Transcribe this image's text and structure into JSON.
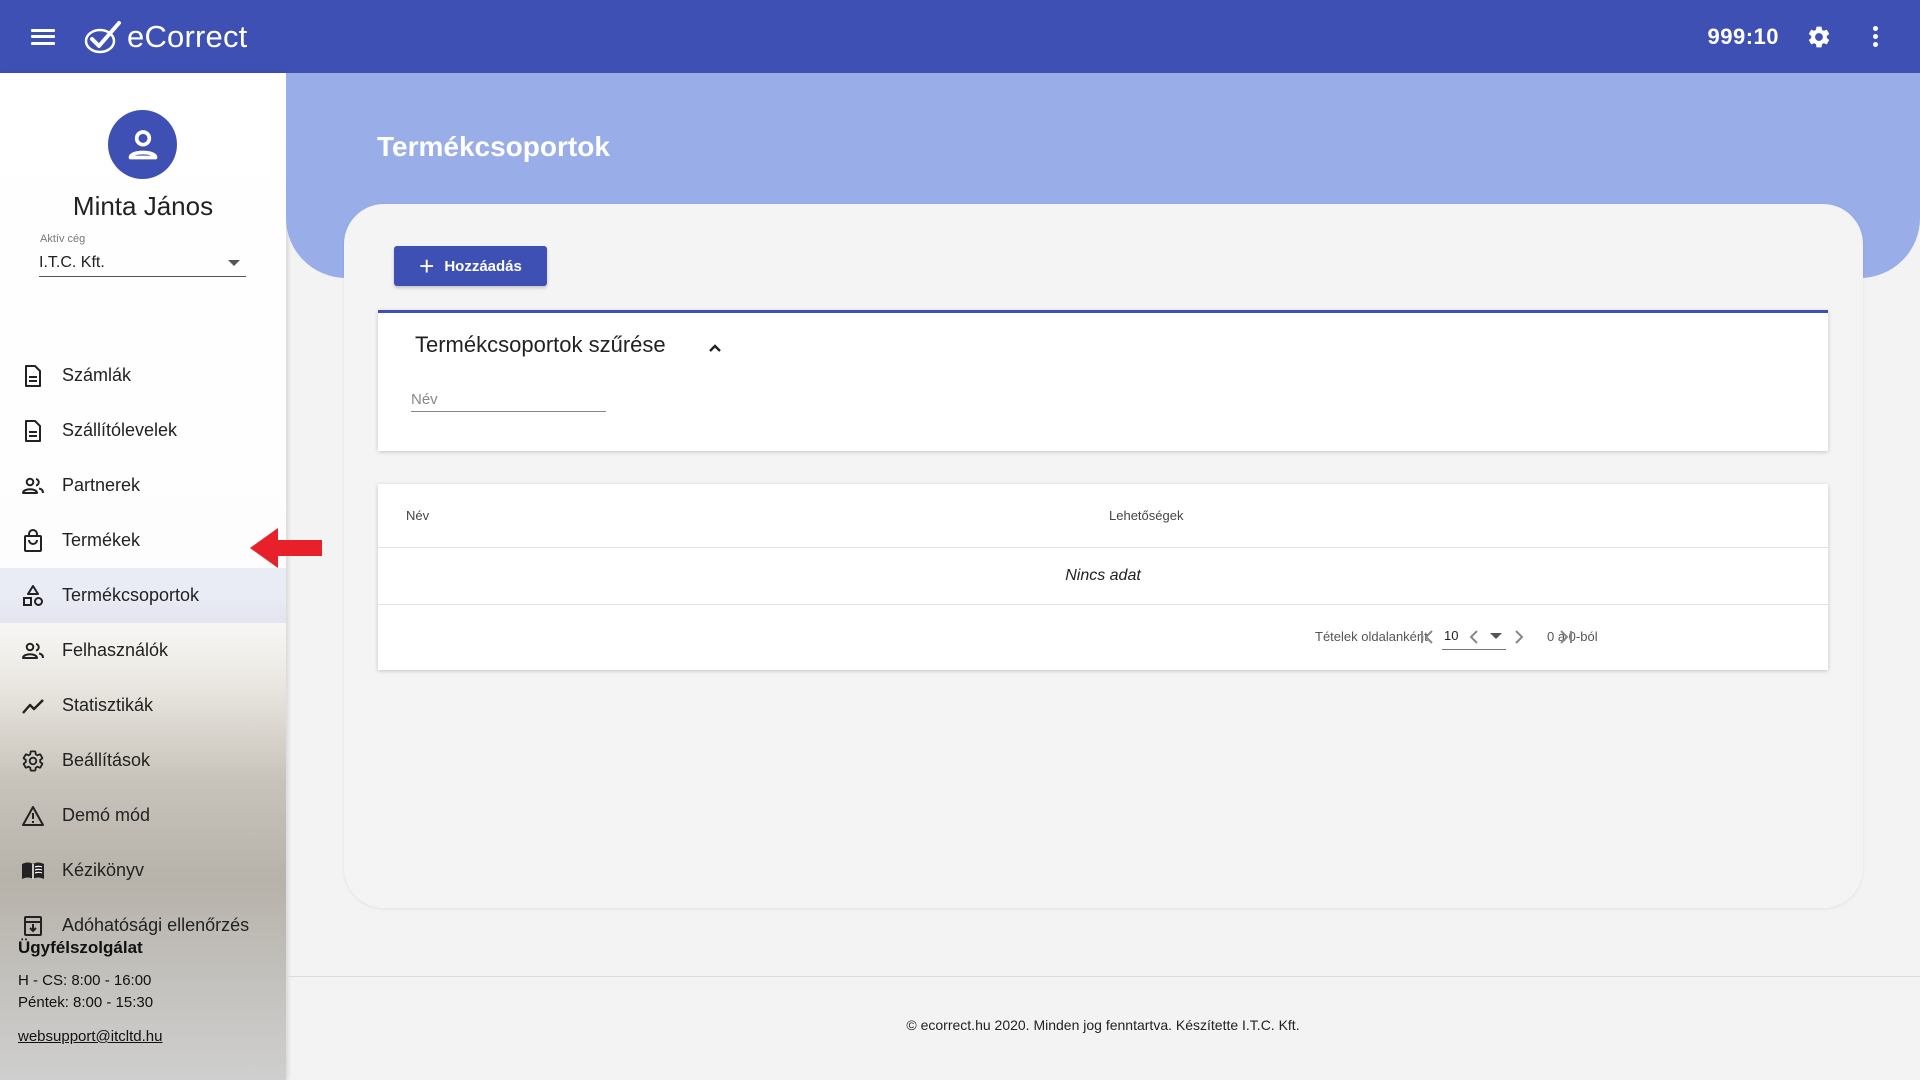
{
  "topbar": {
    "app_name": "eCorrect",
    "timer": "999:10",
    "icons": [
      "menu-icon",
      "ecorrect-logo",
      "gear-icon",
      "more-vert-icon"
    ]
  },
  "sidebar": {
    "user_name": "Minta János",
    "company_label": "Aktív cég",
    "company_value": "I.T.C. Kft.",
    "items": [
      {
        "label": "Számlák",
        "icon": "document-icon"
      },
      {
        "label": "Szállítólevelek",
        "icon": "document-icon"
      },
      {
        "label": "Partnerek",
        "icon": "people-icon"
      },
      {
        "label": "Termékek",
        "icon": "shopping-bag-icon"
      },
      {
        "label": "Termékcsoportok",
        "icon": "category-icon",
        "active": true
      },
      {
        "label": "Felhasználók",
        "icon": "people-icon"
      },
      {
        "label": "Statisztikák",
        "icon": "trending-icon"
      },
      {
        "label": "Beállítások",
        "icon": "gear-icon"
      },
      {
        "label": "Demó mód",
        "icon": "warning-icon"
      },
      {
        "label": "Kézikönyv",
        "icon": "book-icon"
      },
      {
        "label": "Adóhatósági ellenőrzés",
        "icon": "archive-icon"
      }
    ],
    "support": {
      "title": "Ügyfélszolgálat",
      "hours_weekdays": "H - CS: 8:00 - 16:00",
      "hours_friday": "Péntek: 8:00 - 15:30",
      "email": "websupport@itcltd.hu"
    }
  },
  "main": {
    "page_title": "Termékcsoportok",
    "add_button": "Hozzáadás",
    "filter": {
      "title": "Termékcsoportok szűrése",
      "name_placeholder": "Név"
    },
    "table": {
      "columns": [
        "Név",
        "Lehetőségek"
      ],
      "empty_text": "Nincs adat",
      "rows_per_page_label": "Tételek oldalanként",
      "rows_per_page": "10",
      "range_text": "0 a 0-ból"
    }
  },
  "footer": {
    "text": "© ecorrect.hu 2020. Minden jog fenntartva. Készítette I.T.C. Kft."
  },
  "colors": {
    "primary": "#3e50b4",
    "hero": "#99ade8",
    "annotation_arrow": "#e8202a"
  }
}
